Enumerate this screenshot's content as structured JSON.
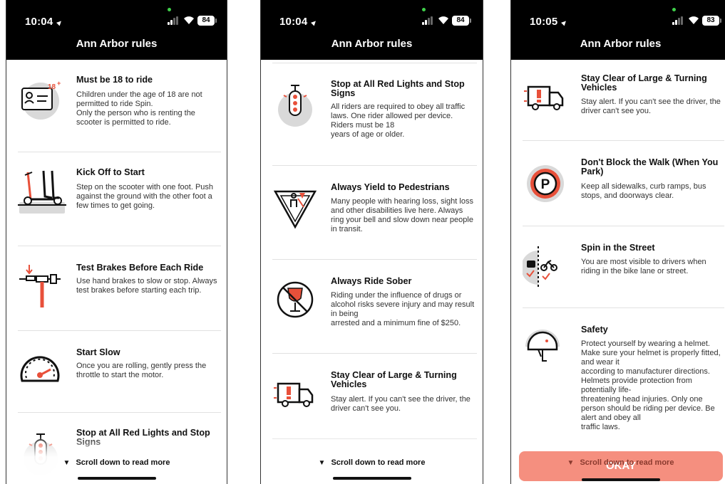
{
  "screens": [
    {
      "status_time": "10:04",
      "battery": "84",
      "title": "Ann Arbor rules",
      "scroll_hint": "Scroll down to read more",
      "rules": [
        {
          "title": "Must be 18 to ride",
          "text": "Children under the age of 18 are not permitted to ride Spin.\nOnly the person who is renting the scooter is permitted to ride.",
          "icon": "id-card-icon"
        },
        {
          "title": "Kick Off to Start",
          "text": "Step on the scooter with one foot. Push against the ground with the other foot a few times to get going.",
          "icon": "kick-scooter-icon"
        },
        {
          "title": "Test Brakes Before Each Ride",
          "text": "Use hand brakes to slow or stop. Always test brakes before starting each trip.",
          "icon": "hand-brake-icon"
        },
        {
          "title": "Start Slow",
          "text": "Once you are rolling, gently press the throttle to start the motor.",
          "icon": "speedometer-icon"
        },
        {
          "title": "Stop at All Red Lights and Stop Signs",
          "text": "",
          "icon": "traffic-light-icon"
        }
      ]
    },
    {
      "status_time": "10:04",
      "battery": "84",
      "title": "Ann Arbor rules",
      "scroll_hint": "Scroll down to read more",
      "rules": [
        {
          "title": "Stop at All Red Lights and Stop Signs",
          "text": "All riders are required to obey all traffic laws. One rider allowed per device. Riders must be 18\nyears of age or older.",
          "icon": "traffic-light-icon"
        },
        {
          "title": "Always Yield to Pedestrians",
          "text": "Many people with hearing loss, sight loss and other disabilities live here. Always ring your bell and slow down near people in transit.",
          "icon": "yield-pedestrian-icon"
        },
        {
          "title": "Always Ride Sober",
          "text": "Riding under the influence of drugs or alcohol risks severe injury and may result in being\narrested and a minimum fine of $250.",
          "icon": "no-alcohol-icon"
        },
        {
          "title": "Stay Clear of Large & Turning Vehicles",
          "text": "Stay alert. If you can't see the driver, the driver can't see you.",
          "icon": "truck-icon"
        }
      ]
    },
    {
      "status_time": "10:05",
      "battery": "83",
      "title": "Ann Arbor rules",
      "scroll_hint": "Scroll down to read more",
      "okay_label": "OKAY",
      "rules": [
        {
          "title": "Stay Clear of Large & Turning Vehicles",
          "text": "Stay alert. If you can't see the driver, the driver can't see you.",
          "icon": "truck-icon"
        },
        {
          "title": "Don't Block the Walk (When You Park)",
          "text": "Keep all sidewalks, curb ramps, bus stops, and doorways clear.",
          "icon": "no-parking-icon"
        },
        {
          "title": "Spin in the Street",
          "text": "You are most visible to drivers when riding in the bike lane or street.",
          "icon": "street-lane-icon"
        },
        {
          "title": "Safety",
          "text": "Protect yourself by wearing a helmet. Make sure your helmet is properly fitted, and wear it\naccording to manufacturer directions. Helmets provide protection from potentially life-\nthreatening head injuries. Only one person should be riding per device. Be alert and obey all\ntraffic laws.",
          "icon": "helmet-icon"
        }
      ]
    }
  ],
  "colors": {
    "accent": "#e8503a",
    "icon_bg": "#d9d9d9",
    "okay_button": "#f58f7f",
    "header_bg": "#000000"
  }
}
